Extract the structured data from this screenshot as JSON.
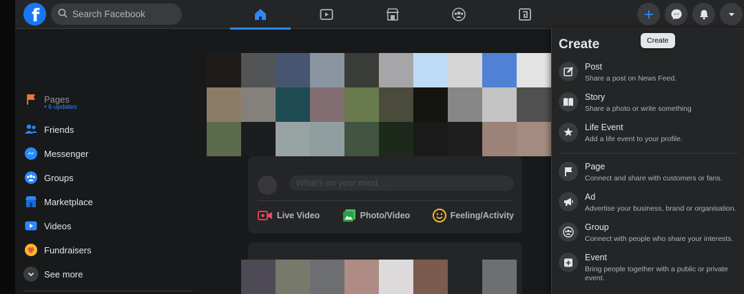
{
  "search": {
    "placeholder": "Search Facebook"
  },
  "nav": {
    "tabs": [
      {
        "name": "home-icon"
      },
      {
        "name": "watch-icon"
      },
      {
        "name": "marketplace-icon"
      },
      {
        "name": "groups-icon"
      },
      {
        "name": "gaming-icon"
      }
    ]
  },
  "header": {
    "buttons": [
      {
        "name": "create-button",
        "icon": "plus-icon"
      },
      {
        "name": "messenger-button",
        "icon": "messenger-icon"
      },
      {
        "name": "notifications-button",
        "icon": "bell-icon"
      },
      {
        "name": "account-button",
        "icon": "caret-down-icon"
      }
    ]
  },
  "sidebar": {
    "pages": {
      "label": "Pages",
      "sub": "• 6 updates"
    },
    "items": [
      {
        "label": "Friends",
        "icon": "friends-icon"
      },
      {
        "label": "Messenger",
        "icon": "messenger-icon"
      },
      {
        "label": "Groups",
        "icon": "groups-icon"
      },
      {
        "label": "Marketplace",
        "icon": "marketplace-icon"
      },
      {
        "label": "Videos",
        "icon": "videos-icon"
      },
      {
        "label": "Fundraisers",
        "icon": "fundraisers-icon"
      },
      {
        "label": "See more",
        "icon": "chevron-down-icon"
      }
    ]
  },
  "composer": {
    "placeholder": "What's on your mind, ...",
    "actions": [
      {
        "label": "Live Video",
        "icon": "live-video-icon",
        "color": "#f3425f"
      },
      {
        "label": "Photo/Video",
        "icon": "photo-icon",
        "color": "#45bd62"
      },
      {
        "label": "Feeling/Activity",
        "icon": "smiley-icon",
        "color": "#f7b928"
      }
    ]
  },
  "create_panel": {
    "title": "Create",
    "items": [
      {
        "title": "Post",
        "desc": "Share a post on News Feed.",
        "icon": "edit-icon"
      },
      {
        "title": "Story",
        "desc": "Share a photo or write something",
        "icon": "book-icon"
      },
      {
        "title": "Life Event",
        "desc": "Add a life event to your profile.",
        "icon": "star-icon"
      },
      {
        "title": "Page",
        "desc": "Connect and share with customers or fans.",
        "icon": "flag-icon"
      },
      {
        "title": "Ad",
        "desc": "Advertise your business, brand or organisation.",
        "icon": "megaphone-icon"
      },
      {
        "title": "Group",
        "desc": "Connect with people who share your interests.",
        "icon": "group-icon"
      },
      {
        "title": "Event",
        "desc": "Bring people together with a public or private event.",
        "icon": "calendar-plus-icon"
      }
    ]
  },
  "tooltip": {
    "text": "Create"
  },
  "colors": {
    "accent": "#2d88ff",
    "brand": "#1877f2",
    "surface": "#242526",
    "background": "#18191a"
  }
}
